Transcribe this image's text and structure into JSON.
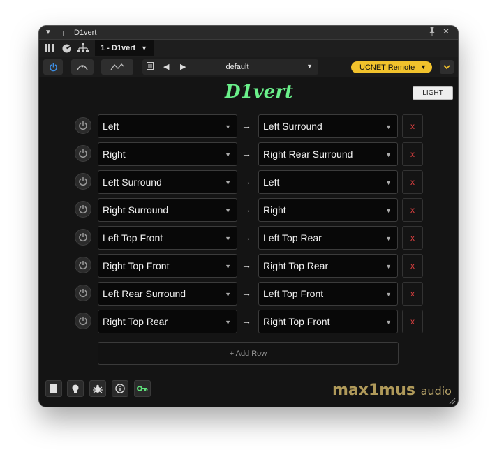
{
  "window": {
    "title": "D1vert",
    "instance": "1 - D1vert"
  },
  "toolbar": {
    "preset": "default",
    "remote": "UCNET Remote"
  },
  "plugin": {
    "logo": "D1vert",
    "theme_button": "LIGHT",
    "add_row": "+ Add Row",
    "brand_main": "max1mus",
    "brand_sub": "audio"
  },
  "rows": [
    {
      "from": "Left",
      "to": "Left Surround"
    },
    {
      "from": "Right",
      "to": "Right Rear Surround"
    },
    {
      "from": "Left Surround",
      "to": "Left"
    },
    {
      "from": "Right Surround",
      "to": "Right"
    },
    {
      "from": "Left Top Front",
      "to": "Left Top Rear"
    },
    {
      "from": "Right Top Front",
      "to": "Right Top Rear"
    },
    {
      "from": "Left Rear Surround",
      "to": "Left Top Front"
    },
    {
      "from": "Right Top Rear",
      "to": "Right Top Front"
    }
  ],
  "symbols": {
    "arrow": "→",
    "remove": "x"
  },
  "colors": {
    "logo_green": "#6af08a",
    "remote_yellow": "#f1c22c",
    "remove_red": "#e04040",
    "brand_gold": "#b09a5a"
  }
}
